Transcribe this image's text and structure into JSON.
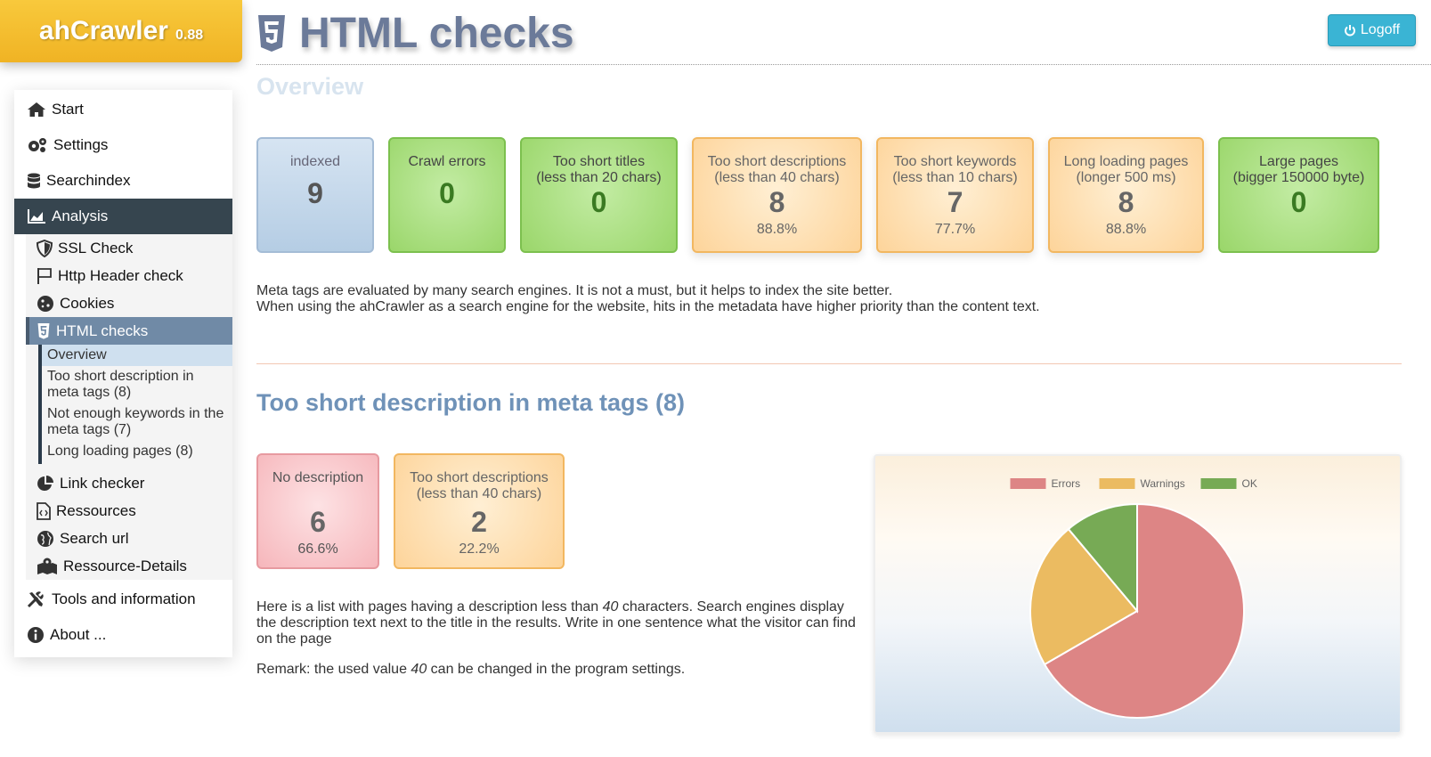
{
  "app": {
    "name": "ahCrawler",
    "version": "0.88"
  },
  "header": {
    "title": "HTML checks",
    "logoff_label": "Logoff"
  },
  "sidebar": {
    "items": [
      {
        "label": "Start",
        "icon": "home-icon"
      },
      {
        "label": "Settings",
        "icon": "gears-icon"
      },
      {
        "label": "Searchindex",
        "icon": "database-icon"
      },
      {
        "label": "Analysis",
        "icon": "chart-area-icon",
        "active": true
      }
    ],
    "analysis_sub": [
      {
        "label": "SSL Check",
        "icon": "shield-icon"
      },
      {
        "label": "Http Header check",
        "icon": "flag-icon"
      },
      {
        "label": "Cookies",
        "icon": "cookie-icon"
      },
      {
        "label": "HTML checks",
        "icon": "html5-icon",
        "active": true
      }
    ],
    "html_checks_sub": [
      {
        "label": "Overview",
        "active": true
      },
      {
        "label": "Too short description in meta tags (8)"
      },
      {
        "label": "Not enough keywords in the meta tags (7)"
      },
      {
        "label": "Long loading pages (8)"
      }
    ],
    "analysis_sub_after": [
      {
        "label": "Link checker",
        "icon": "pie-chart-icon"
      },
      {
        "label": "Ressources",
        "icon": "file-code-icon"
      },
      {
        "label": "Search url",
        "icon": "globe-icon"
      },
      {
        "label": "Ressource-Details",
        "icon": "map-marked-icon"
      }
    ],
    "bottom_items": [
      {
        "label": "Tools and information",
        "icon": "tools-icon"
      },
      {
        "label": "About ...",
        "icon": "info-circle-icon"
      }
    ]
  },
  "overview": {
    "title": "Overview",
    "tiles": [
      {
        "label": "indexed",
        "value": "9",
        "percent": "",
        "status": "info"
      },
      {
        "label": "Crawl errors",
        "value": "0",
        "percent": "",
        "status": "ok"
      },
      {
        "label": "Too short titles\n(less than 20 chars)",
        "value": "0",
        "percent": "",
        "status": "ok"
      },
      {
        "label": "Too short descriptions\n(less than 40 chars)",
        "value": "8",
        "percent": "88.8%",
        "status": "warning"
      },
      {
        "label": "Too short keywords\n(less than 10 chars)",
        "value": "7",
        "percent": "77.7%",
        "status": "warning"
      },
      {
        "label": "Long loading pages\n(longer 500 ms)",
        "value": "8",
        "percent": "88.8%",
        "status": "warning"
      },
      {
        "label": "Large pages\n(bigger 150000 byte)",
        "value": "0",
        "percent": "",
        "status": "ok"
      }
    ],
    "text_1": "Meta tags are evaluated by many search engines. It is not a must, but it helps to index the site better.",
    "text_2": "When using the ahCrawler as a search engine for the website, hits in the metadata have higher priority than the content text."
  },
  "short_desc": {
    "title": "Too short description in meta tags (8)",
    "tiles": [
      {
        "label": "No description",
        "value": "6",
        "percent": "66.6%",
        "status": "error"
      },
      {
        "label": "Too short descriptions\n(less than 40 chars)",
        "value": "2",
        "percent": "22.2%",
        "status": "warning"
      }
    ],
    "text_a": "Here is a list with pages having a description less than ",
    "text_a_num": "40",
    "text_a_end": " characters. Search engines display the description text next to the title in the results. Write in one sentence what the visitor can find on the page",
    "remark_a": "Remark: the used value ",
    "remark_num": "40",
    "remark_end": " can be changed in the program settings."
  },
  "chart_data": {
    "type": "pie",
    "categories": [
      "Errors",
      "Warnings",
      "OK"
    ],
    "values": [
      6,
      2,
      1
    ],
    "colors": [
      "#dd8585",
      "#ebbb61",
      "#77aa55"
    ],
    "legend_position": "top"
  }
}
